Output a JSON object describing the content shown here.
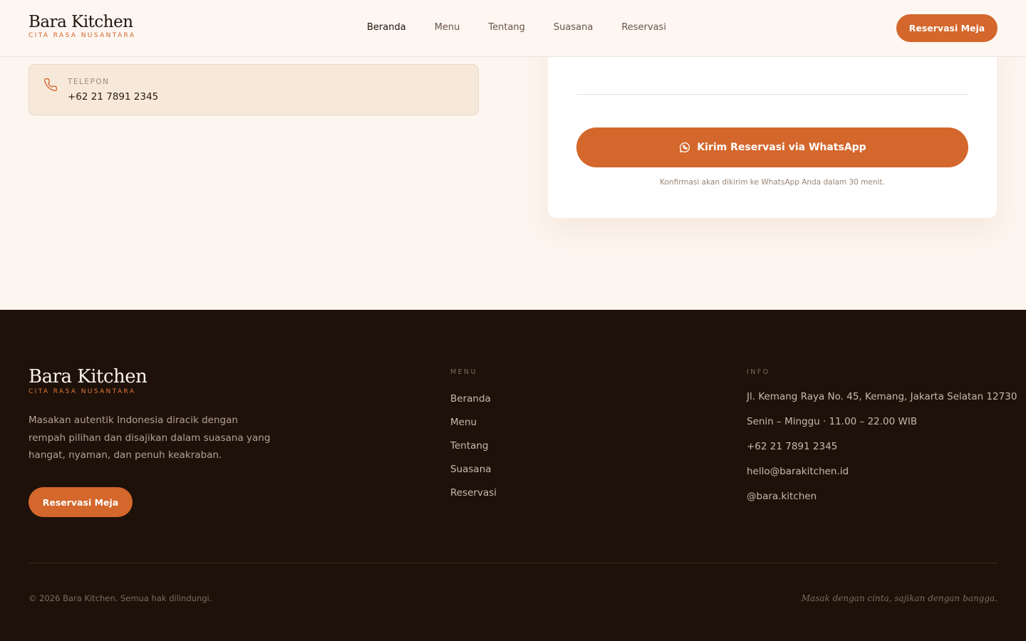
{
  "brand": {
    "name": "Bara Kitchen",
    "tagline": "CITA RASA NUSANTARA"
  },
  "nav": {
    "items": [
      {
        "label": "Beranda",
        "active": true
      },
      {
        "label": "Menu"
      },
      {
        "label": "Tentang"
      },
      {
        "label": "Suasana"
      },
      {
        "label": "Reservasi"
      }
    ],
    "cta": "Reservasi Meja"
  },
  "contact": {
    "phone_label": "TELEPON",
    "phone_value": "+62 21 7891 2345",
    "icon": "phone-icon"
  },
  "form": {
    "submit_label": "Kirim Reservasi via WhatsApp",
    "submit_icon": "whatsapp-icon",
    "note": "Konfirmasi akan dikirim ke WhatsApp Anda dalam 30 menit."
  },
  "footer": {
    "brand_name": "Bara Kitchen",
    "brand_tagline": "CITA RASA NUSANTARA",
    "description": "Masakan autentik Indonesia diracik dengan rempah pilihan dan disajikan dalam suasana yang hangat, nyaman, dan penuh keakraban.",
    "cta": "Reservasi Meja",
    "menu_title": "MENU",
    "menu_items": [
      "Beranda",
      "Menu",
      "Tentang",
      "Suasana",
      "Reservasi"
    ],
    "info_title": "INFO",
    "info_items": [
      "Jl. Kemang Raya No. 45, Kemang, Jakarta Selatan 12730",
      "Senin – Minggu · 11.00 – 22.00 WIB",
      "+62 21 7891 2345",
      "hello@barakitchen.id",
      "@bara.kitchen"
    ],
    "copyright": "© 2026 Bara Kitchen. Semua hak dilindungi.",
    "slogan": "Masak dengan cinta, sajikan dengan bangga."
  },
  "colors": {
    "accent": "#d4672c",
    "background": "#fdf5ef",
    "footer_bg": "#1e1109",
    "card_bg": "#f6e9da"
  }
}
